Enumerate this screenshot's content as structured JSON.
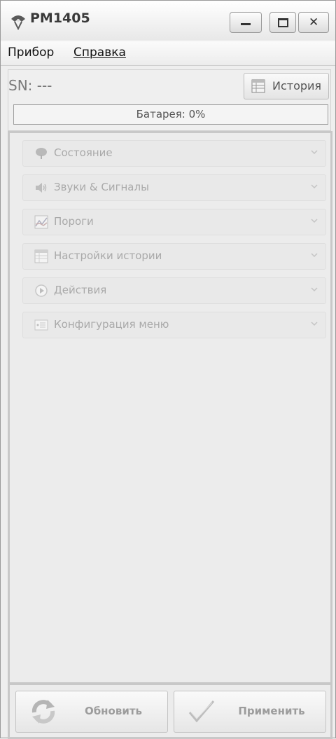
{
  "window": {
    "title": "PM1405"
  },
  "menu": {
    "items": [
      {
        "label": "Прибор"
      },
      {
        "label": "Справка"
      }
    ]
  },
  "device": {
    "sn_text": "SN: ---",
    "history_label": "История",
    "battery_label": "Батарея: 0%",
    "battery_percent": 0
  },
  "sections": [
    {
      "label": "Состояние",
      "icon": "tree-icon"
    },
    {
      "label": "Звуки & Сигналы",
      "icon": "speaker-icon"
    },
    {
      "label": "Пороги",
      "icon": "chart-icon"
    },
    {
      "label": "Настройки истории",
      "icon": "table-icon"
    },
    {
      "label": "Действия",
      "icon": "play-circle-icon"
    },
    {
      "label": "Конфигурация меню",
      "icon": "menu-list-icon"
    }
  ],
  "actions": {
    "refresh_label": "Обновить",
    "apply_label": "Применить"
  }
}
